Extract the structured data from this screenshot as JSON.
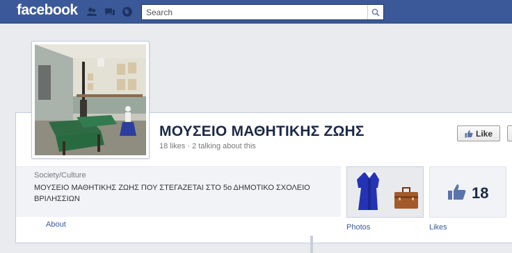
{
  "header": {
    "logo_text": "facebook",
    "search": {
      "placeholder": "Search",
      "value": ""
    },
    "icons": [
      "friend-requests-icon",
      "messages-icon",
      "notifications-icon",
      "search-icon"
    ],
    "colors": {
      "bar": "#3b5998"
    }
  },
  "page": {
    "name": "ΜΟΥΣΕΙΟ ΜΑΘΗΤΙΚΗΣ ΖΩΗΣ",
    "stats": "18 likes · 2 talking about this",
    "like_button_label": "Like"
  },
  "about": {
    "category": "Society/Culture",
    "description": "ΜΟΥΣΕΙΟ ΜΑΘΗΤΙΚΗΣ ΖΩΗΣ ΠΟΥ ΣΤΕΓΑΖΕΤΑΙ ΣΤΟ 5ο ΔΗΜΟΤΙΚΟ ΣΧΟΛΕΙΟ ΒΡΙΛΗΣΣΙΩΝ",
    "link_label": "About"
  },
  "apps": [
    {
      "label": "Photos",
      "icon": "photos-thumbnail"
    },
    {
      "label": "Likes",
      "count": "18",
      "icon": "thumbs-up-icon"
    }
  ]
}
